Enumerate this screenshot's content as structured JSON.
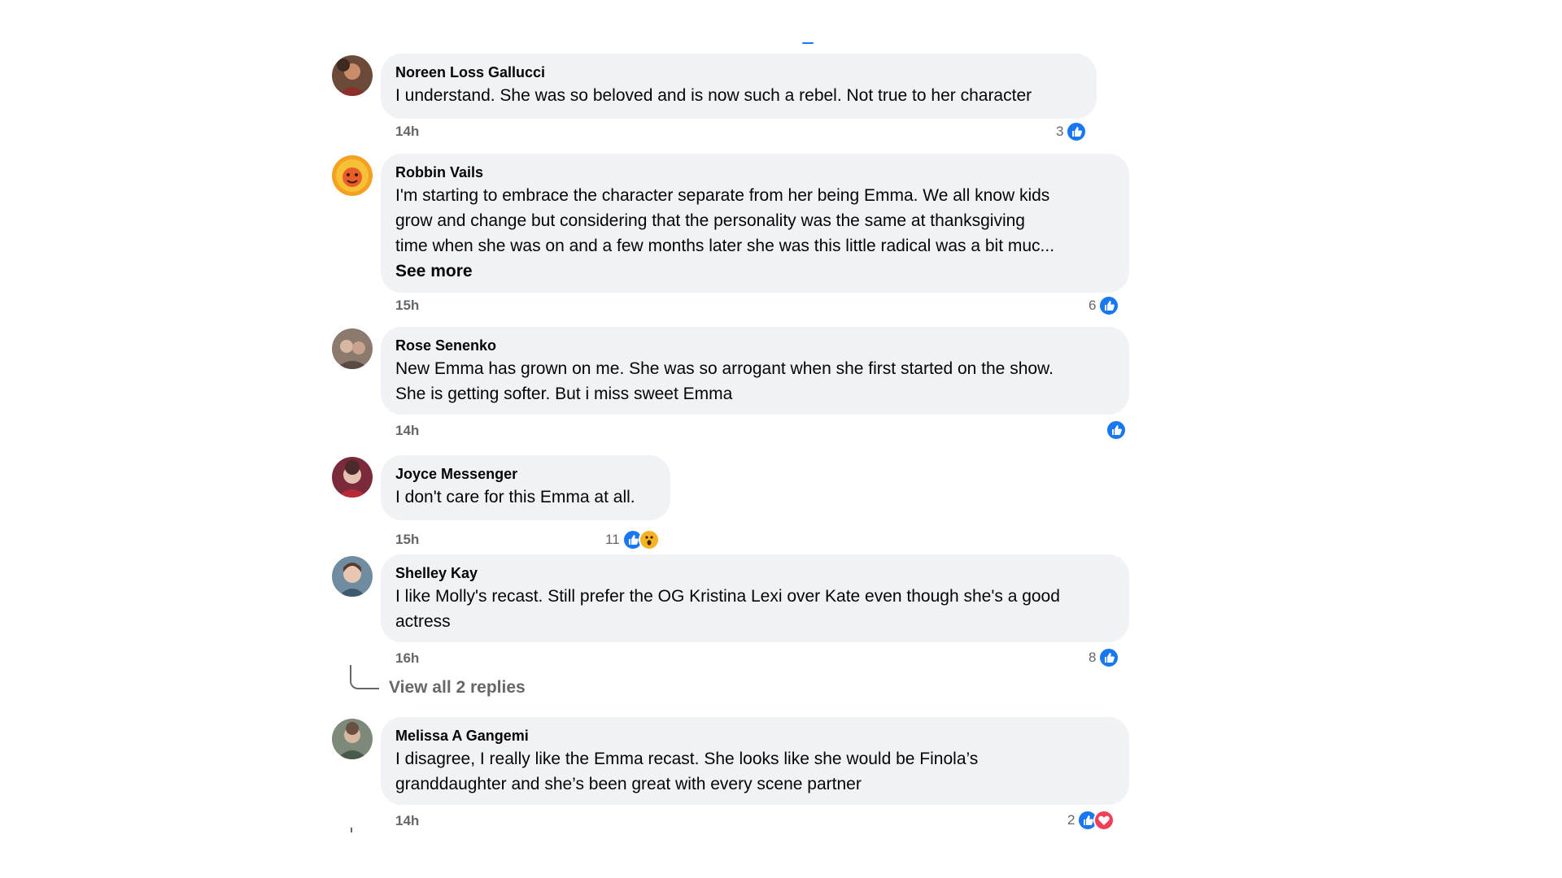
{
  "comments": [
    {
      "author": "Noreen Loss Gallucci",
      "lines": [
        "I understand. She was so beloved and is now such a rebel. Not true to her character"
      ],
      "time": "14h",
      "reaction_count": "3",
      "reactions": [
        "like-icon"
      ]
    },
    {
      "author": "Robbin Vails",
      "lines": [
        "I'm starting to embrace the character separate from her being Emma. We all know kids",
        "grow and change but considering that the personality was the same at thanksgiving",
        "time when she was on and a few months later she was this little radical was a bit muc..."
      ],
      "see_more": "See more",
      "time": "15h",
      "reaction_count": "6",
      "reactions": [
        "like-icon"
      ]
    },
    {
      "author": "Rose Senenko",
      "lines": [
        "New Emma has grown on me. She was so arrogant when she first started on the show.",
        "She is getting softer. But i miss sweet Emma"
      ],
      "time": "14h",
      "reaction_count": "",
      "reactions": [
        "like-icon"
      ]
    },
    {
      "author": "Joyce Messenger",
      "lines": [
        "I don't care for this Emma at all."
      ],
      "time": "15h",
      "reaction_count": "11",
      "reactions": [
        "like-icon",
        "wow-icon"
      ]
    },
    {
      "author": "Shelley Kay",
      "lines": [
        "I like Molly's recast. Still prefer the OG Kristina Lexi over Kate even though she's a good",
        "actress"
      ],
      "time": "16h",
      "reaction_count": "8",
      "reactions": [
        "like-icon"
      ],
      "view_replies": "View all 2 replies"
    },
    {
      "author": "Melissa A Gangemi",
      "lines": [
        "I disagree, I really like the Emma recast. She looks like she would be Finola’s",
        "granddaughter and she’s been great with every scene partner"
      ],
      "time": "14h",
      "reaction_count": "2",
      "reactions": [
        "like-icon",
        "love-icon"
      ]
    }
  ],
  "colors": {
    "bubble": "#f0f2f5",
    "meta_text": "#65676b",
    "like_blue": "#1877f2",
    "love_red": "#f33e58",
    "wow_yellow": "#f7b125"
  }
}
